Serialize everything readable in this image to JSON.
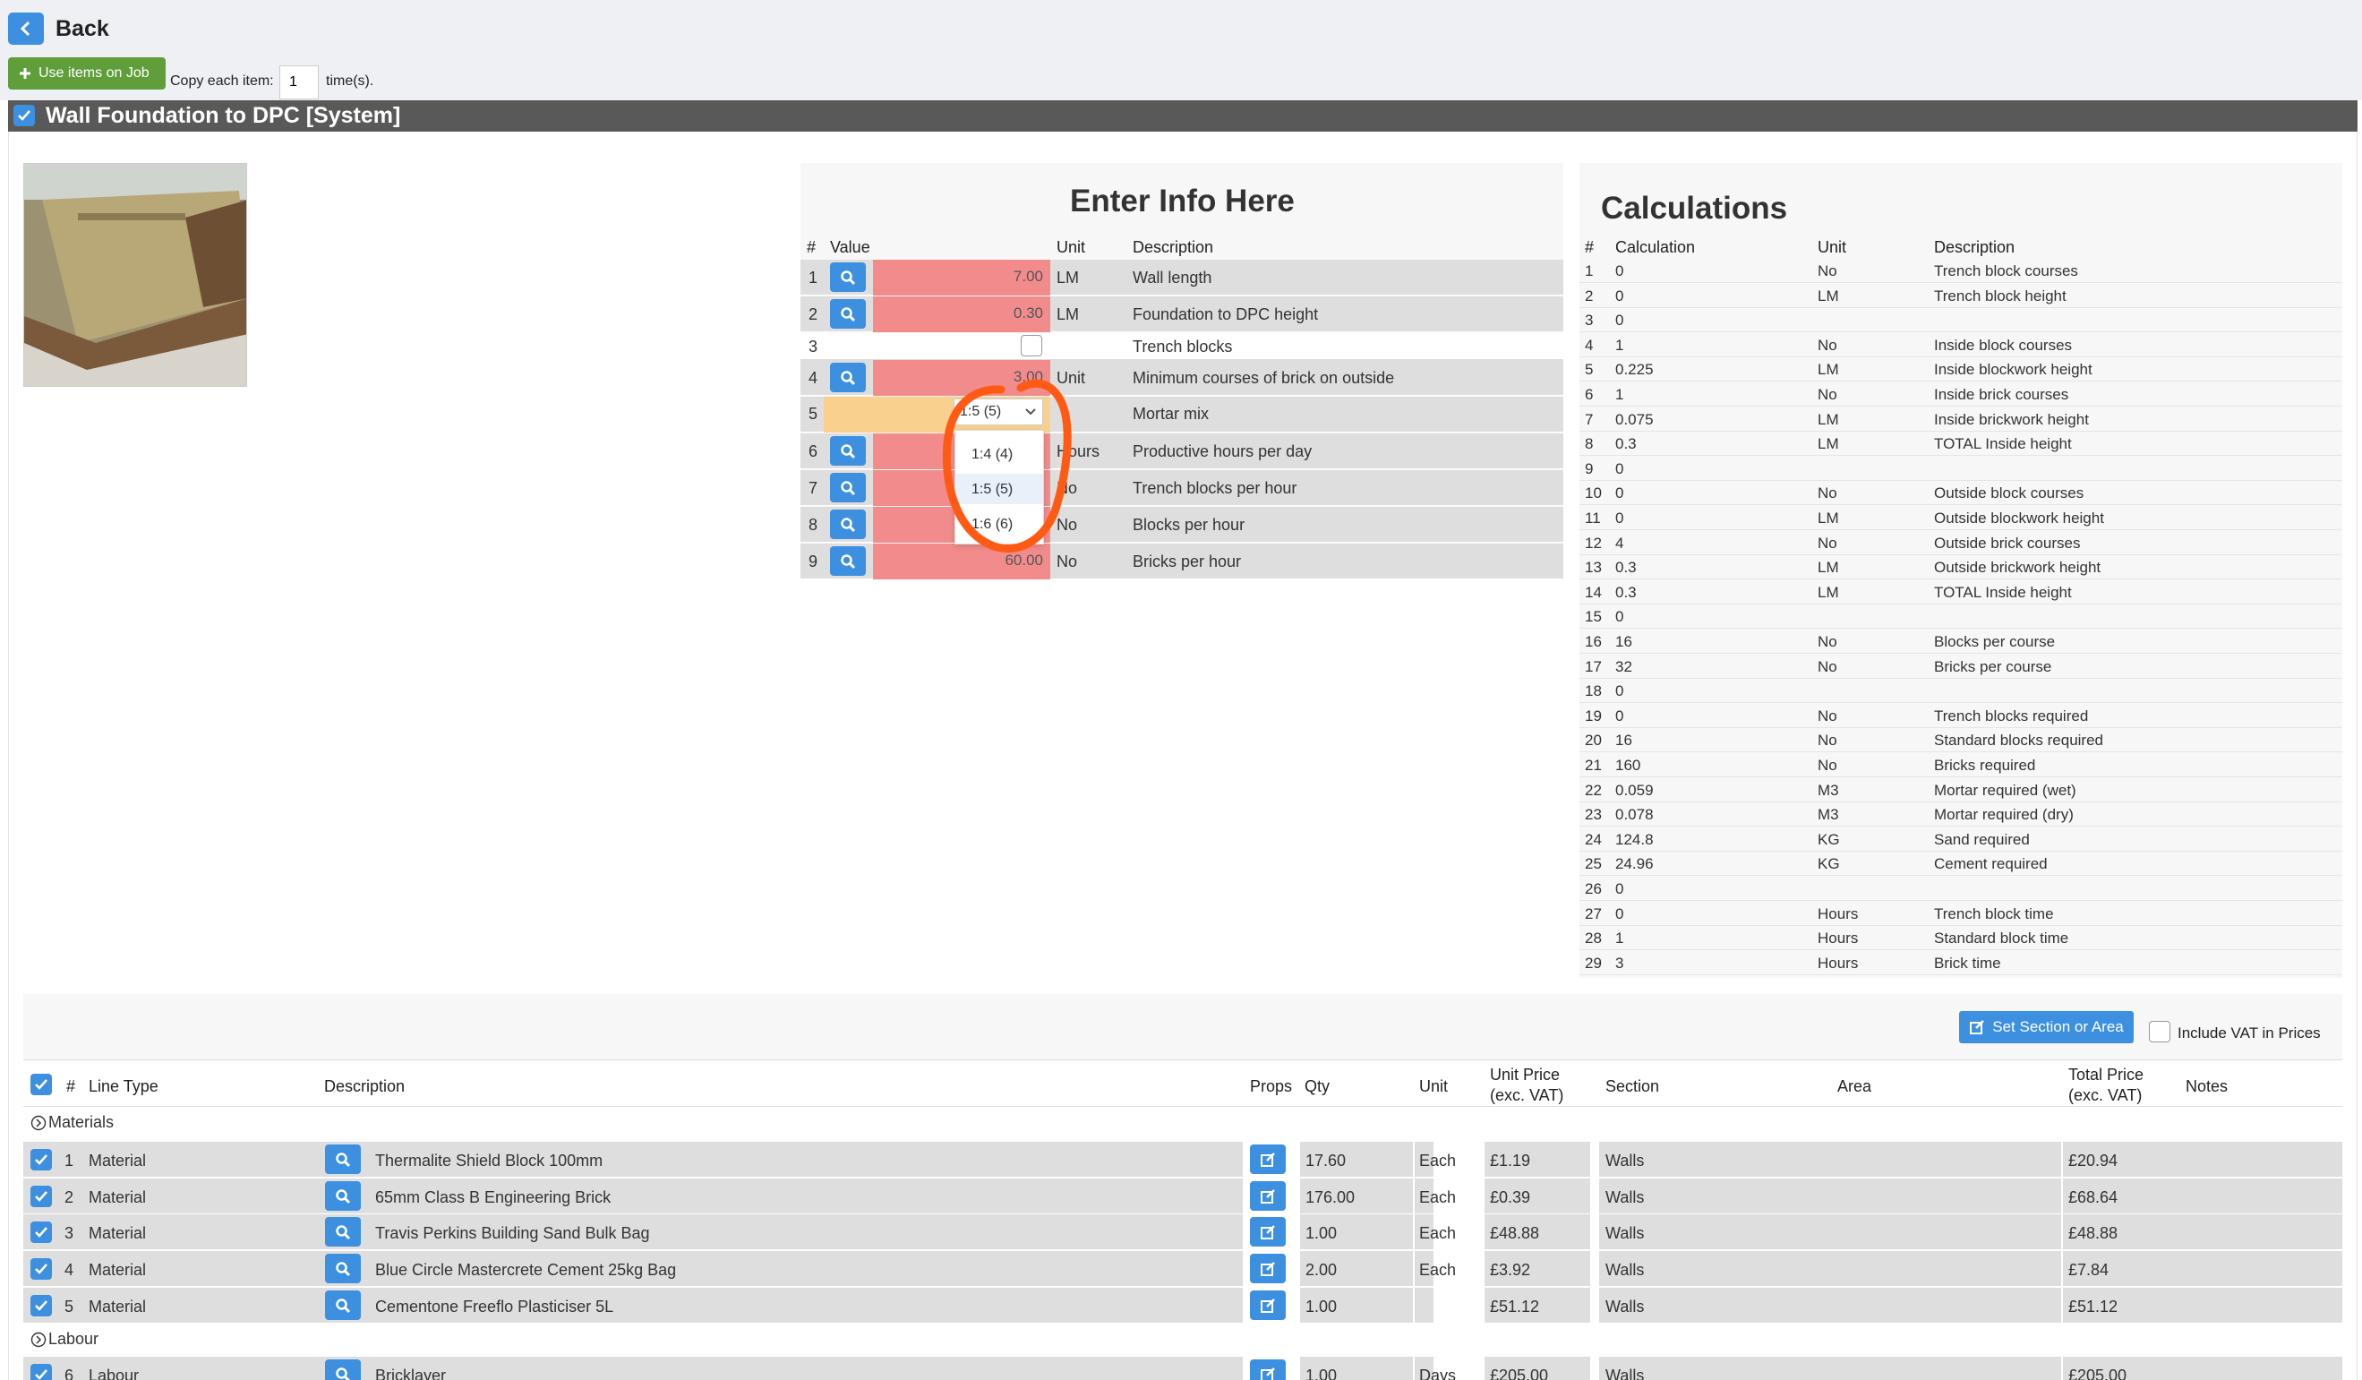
{
  "header": {
    "back_label": "Back",
    "use_items_label": "Use items on Job",
    "copy_label": "Copy each item:",
    "copy_value": "1",
    "times_label": "time(s).",
    "section_title": "Wall Foundation to DPC [System]"
  },
  "enter_info": {
    "title": "Enter Info Here",
    "headers": {
      "num": "#",
      "value": "Value",
      "unit": "Unit",
      "description": "Description"
    },
    "rows": [
      {
        "num": "1",
        "value": "7.00",
        "unit": "LM",
        "description": "Wall length"
      },
      {
        "num": "2",
        "value": "0.30",
        "unit": "LM",
        "description": "Foundation to DPC height"
      },
      {
        "num": "3",
        "value": "",
        "unit": "",
        "description": "Trench blocks"
      },
      {
        "num": "4",
        "value": "3.00",
        "unit": "Unit",
        "description": "Minimum courses of brick on outside"
      },
      {
        "num": "5",
        "value": "1:5 (5)",
        "unit": "",
        "description": "Mortar mix"
      },
      {
        "num": "6",
        "value": "",
        "unit": "Hours",
        "description": "Productive hours per day"
      },
      {
        "num": "7",
        "value": "",
        "unit": "No",
        "description": "Trench blocks per hour"
      },
      {
        "num": "8",
        "value": "",
        "unit": "No",
        "description": "Blocks per hour"
      },
      {
        "num": "9",
        "value": "60.00",
        "unit": "No",
        "description": "Bricks per hour"
      }
    ],
    "dropdown_options": [
      "1:4 (4)",
      "1:5 (5)",
      "1:6 (6)"
    ]
  },
  "calculations": {
    "title": "Calculations",
    "headers": {
      "num": "#",
      "calculation": "Calculation",
      "unit": "Unit",
      "description": "Description"
    },
    "rows": [
      {
        "num": "1",
        "calc": "0",
        "unit": "No",
        "desc": "Trench block courses"
      },
      {
        "num": "2",
        "calc": "0",
        "unit": "LM",
        "desc": "Trench block height"
      },
      {
        "num": "3",
        "calc": "0",
        "unit": "",
        "desc": ""
      },
      {
        "num": "4",
        "calc": "1",
        "unit": "No",
        "desc": "Inside block courses"
      },
      {
        "num": "5",
        "calc": "0.225",
        "unit": "LM",
        "desc": "Inside blockwork height"
      },
      {
        "num": "6",
        "calc": "1",
        "unit": "No",
        "desc": "Inside brick courses"
      },
      {
        "num": "7",
        "calc": "0.075",
        "unit": "LM",
        "desc": "Inside brickwork height"
      },
      {
        "num": "8",
        "calc": "0.3",
        "unit": "LM",
        "desc": "TOTAL Inside height"
      },
      {
        "num": "9",
        "calc": "0",
        "unit": "",
        "desc": ""
      },
      {
        "num": "10",
        "calc": "0",
        "unit": "No",
        "desc": "Outside block courses"
      },
      {
        "num": "11",
        "calc": "0",
        "unit": "LM",
        "desc": "Outside blockwork height"
      },
      {
        "num": "12",
        "calc": "4",
        "unit": "No",
        "desc": "Outside brick courses"
      },
      {
        "num": "13",
        "calc": "0.3",
        "unit": "LM",
        "desc": "Outside brickwork height"
      },
      {
        "num": "14",
        "calc": "0.3",
        "unit": "LM",
        "desc": "TOTAL Inside height"
      },
      {
        "num": "15",
        "calc": "0",
        "unit": "",
        "desc": ""
      },
      {
        "num": "16",
        "calc": "16",
        "unit": "No",
        "desc": "Blocks per course"
      },
      {
        "num": "17",
        "calc": "32",
        "unit": "No",
        "desc": "Bricks per course"
      },
      {
        "num": "18",
        "calc": "0",
        "unit": "",
        "desc": ""
      },
      {
        "num": "19",
        "calc": "0",
        "unit": "No",
        "desc": "Trench blocks required"
      },
      {
        "num": "20",
        "calc": "16",
        "unit": "No",
        "desc": "Standard blocks required"
      },
      {
        "num": "21",
        "calc": "160",
        "unit": "No",
        "desc": "Bricks required"
      },
      {
        "num": "22",
        "calc": "0.059",
        "unit": "M3",
        "desc": "Mortar required (wet)"
      },
      {
        "num": "23",
        "calc": "0.078",
        "unit": "M3",
        "desc": "Mortar required (dry)"
      },
      {
        "num": "24",
        "calc": "124.8",
        "unit": "KG",
        "desc": "Sand required"
      },
      {
        "num": "25",
        "calc": "24.96",
        "unit": "KG",
        "desc": "Cement required"
      },
      {
        "num": "26",
        "calc": "0",
        "unit": "",
        "desc": ""
      },
      {
        "num": "27",
        "calc": "0",
        "unit": "Hours",
        "desc": "Trench block time"
      },
      {
        "num": "28",
        "calc": "1",
        "unit": "Hours",
        "desc": "Standard block time"
      },
      {
        "num": "29",
        "calc": "3",
        "unit": "Hours",
        "desc": "Brick time"
      }
    ]
  },
  "lines": {
    "set_section_label": "Set Section or Area",
    "include_vat_label": "Include VAT in Prices",
    "headers": {
      "num": "#",
      "line_type": "Line Type",
      "description": "Description",
      "props": "Props",
      "qty": "Qty",
      "unit": "Unit",
      "unit_price": "Unit Price",
      "unit_price_sub": "(exc. VAT)",
      "section": "Section",
      "area": "Area",
      "total_price": "Total Price",
      "total_price_sub": "(exc. VAT)",
      "notes": "Notes"
    },
    "materials_label": "Materials",
    "labour_label": "Labour",
    "materials": [
      {
        "num": "1",
        "type": "Material",
        "desc": "Thermalite Shield Block 100mm",
        "qty": "17.60",
        "unit": "Each",
        "price": "£1.19",
        "section": "Walls",
        "total": "£20.94"
      },
      {
        "num": "2",
        "type": "Material",
        "desc": "65mm Class B Engineering Brick",
        "qty": "176.00",
        "unit": "Each",
        "price": "£0.39",
        "section": "Walls",
        "total": "£68.64"
      },
      {
        "num": "3",
        "type": "Material",
        "desc": "Travis Perkins Building Sand Bulk Bag",
        "qty": "1.00",
        "unit": "Each",
        "price": "£48.88",
        "section": "Walls",
        "total": "£48.88"
      },
      {
        "num": "4",
        "type": "Material",
        "desc": "Blue Circle Mastercrete Cement 25kg Bag",
        "qty": "2.00",
        "unit": "Each",
        "price": "£3.92",
        "section": "Walls",
        "total": "£7.84"
      },
      {
        "num": "5",
        "type": "Material",
        "desc": "Cementone Freeflo Plasticiser 5L",
        "qty": "1.00",
        "unit": "",
        "price": "£51.12",
        "section": "Walls",
        "total": "£51.12"
      }
    ],
    "labour": [
      {
        "num": "6",
        "type": "Labour",
        "desc": "Bricklayer",
        "qty": "1.00",
        "unit": "Days",
        "price": "£205.00",
        "section": "Walls",
        "total": "£205.00"
      }
    ]
  },
  "colors": {
    "accent": "#3d8fe0",
    "value_red": "#f28c8c",
    "mortar_orange": "#f9d08e",
    "green": "#5f9e3a",
    "annotation": "#ff5a14"
  }
}
